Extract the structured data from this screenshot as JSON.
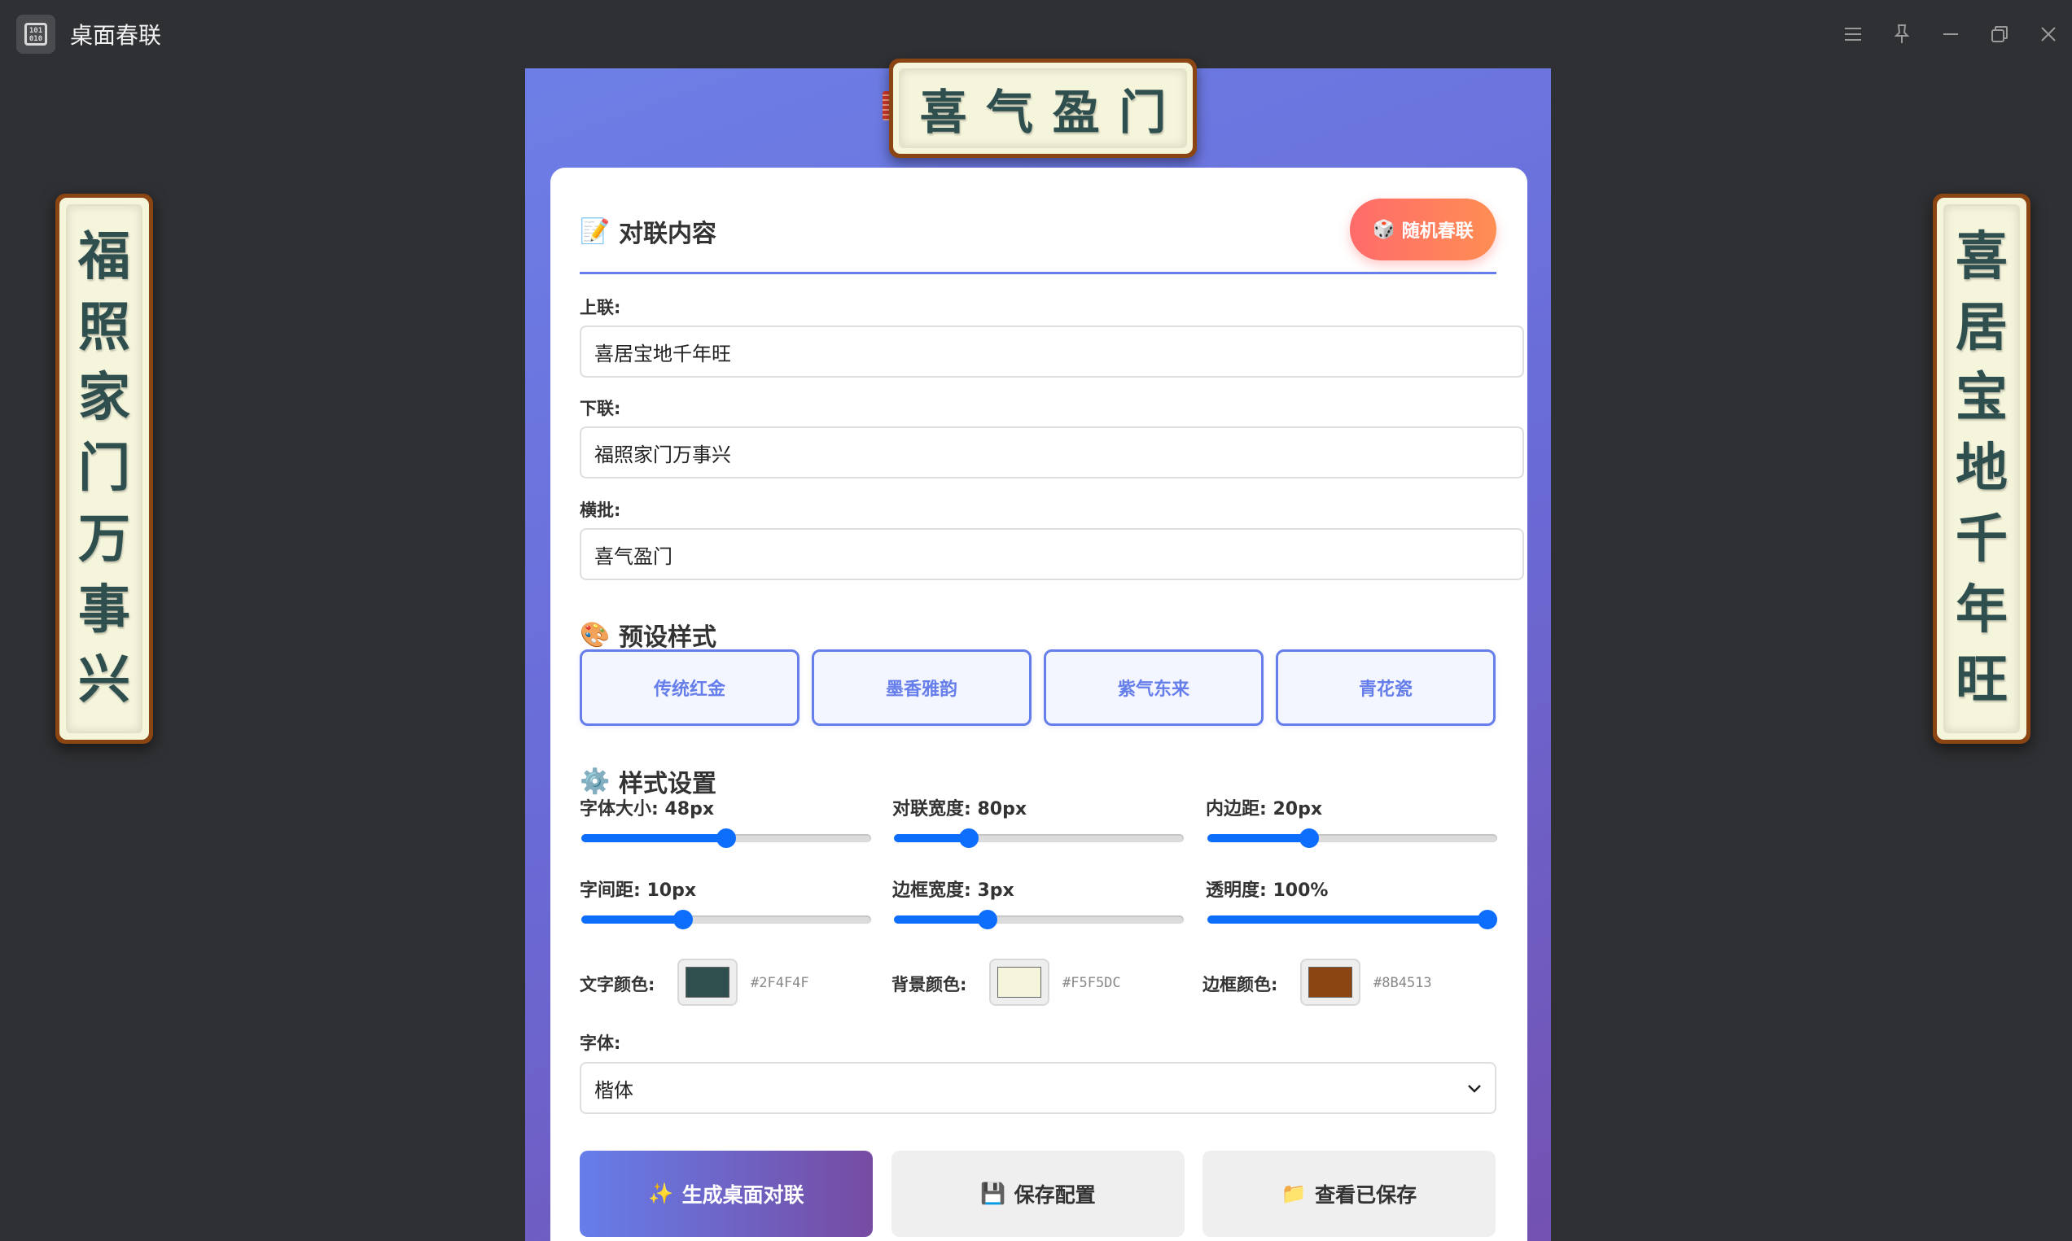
{
  "window": {
    "title": "桌面春联",
    "controls": [
      "menu-icon",
      "pin-icon",
      "minimize-icon",
      "restore-icon",
      "close-icon"
    ]
  },
  "couplet": {
    "upper": "喜居宝地千年旺",
    "lower": "福照家门万事兴",
    "horizontal": "喜气盈门"
  },
  "content": {
    "title": "对联内容",
    "random_button": "随机春联",
    "upper_label": "上联:",
    "upper_value": "喜居宝地千年旺",
    "lower_label": "下联:",
    "lower_value": "福照家门万事兴",
    "horizontal_label": "横批:",
    "horizontal_value": "喜气盈门"
  },
  "presets": {
    "title": "预设样式",
    "items": [
      "传统红金",
      "墨香雅韵",
      "紫气东来",
      "青花瓷"
    ]
  },
  "style": {
    "title": "样式设置",
    "sliders": [
      {
        "label": "字体大小: 48px",
        "fraction": 0.5
      },
      {
        "label": "对联宽度: 80px",
        "fraction": 0.24
      },
      {
        "label": "内边距: 20px",
        "fraction": 0.34
      },
      {
        "label": "字间距: 10px",
        "fraction": 0.34
      },
      {
        "label": "边框宽度: 3px",
        "fraction": 0.31
      },
      {
        "label": "透明度: 100%",
        "fraction": 1.0
      }
    ],
    "colors": [
      {
        "label": "文字颜色:",
        "value": "#2F4F4F"
      },
      {
        "label": "背景颜色:",
        "value": "#F5F5DC"
      },
      {
        "label": "边框颜色:",
        "value": "#8B4513"
      }
    ],
    "font_label": "字体:",
    "font_value": "楷体"
  },
  "actions": {
    "generate": "生成桌面对联",
    "save": "保存配置",
    "view_saved": "查看已保存"
  },
  "accent": {
    "primary": "#667eea",
    "secondary": "#764ba2",
    "slider": "#0d6efd"
  }
}
